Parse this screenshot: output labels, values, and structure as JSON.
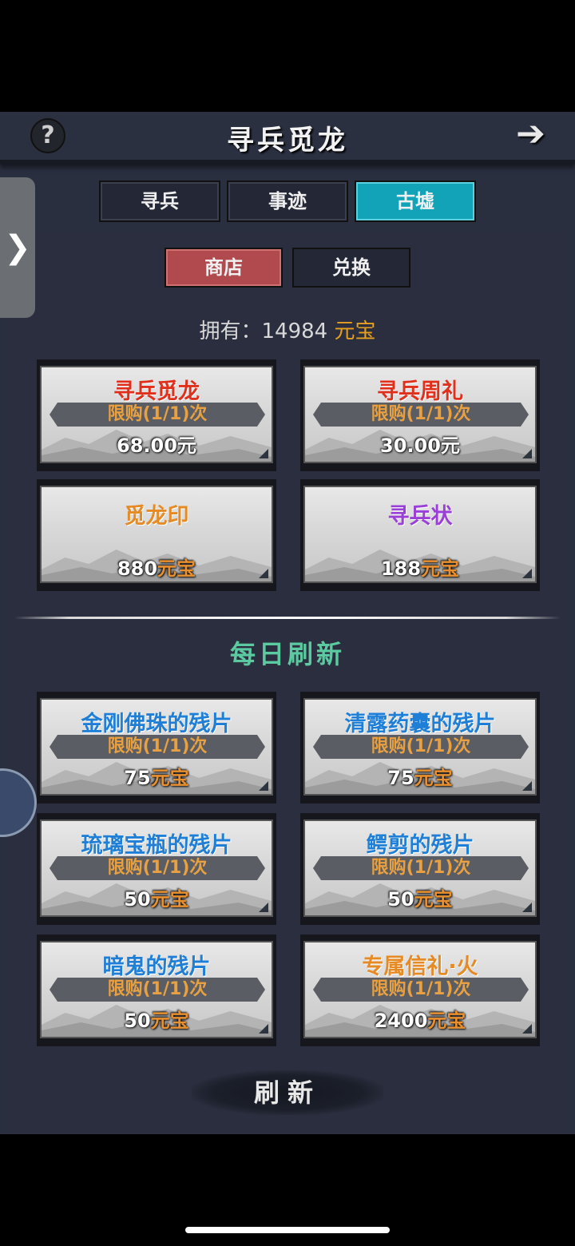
{
  "header": {
    "title": "寻兵觅龙",
    "help_icon": "?",
    "back_icon": "➔"
  },
  "main_tabs": [
    {
      "label": "寻兵",
      "active": false
    },
    {
      "label": "事迹",
      "active": false
    },
    {
      "label": "古墟",
      "active": true
    }
  ],
  "sub_tabs": [
    {
      "label": "商店",
      "active": true
    },
    {
      "label": "兑换",
      "active": false
    }
  ],
  "owned": {
    "label": "拥有：",
    "amount": "14984",
    "currency": "元宝"
  },
  "shop_items": [
    {
      "name": "寻兵觅龙",
      "limit": "限购(1/1)次",
      "price": "68.00元",
      "name_color": "#e0301c"
    },
    {
      "name": "寻兵周礼",
      "limit": "限购(1/1)次",
      "price": "30.00元",
      "name_color": "#e0301c"
    },
    {
      "name": "觅龙印",
      "price_value": "880",
      "price_currency": "元宝",
      "name_color": "#e58a24"
    },
    {
      "name": "寻兵状",
      "price_value": "188",
      "price_currency": "元宝",
      "name_color": "#9a40d8"
    }
  ],
  "daily": {
    "title": "每日刷新",
    "items": [
      {
        "name": "金刚佛珠的残片",
        "limit": "限购(1/1)次",
        "price_value": "75",
        "price_currency": "元宝",
        "name_color": "#1f7fd6"
      },
      {
        "name": "清露药囊的残片",
        "limit": "限购(1/1)次",
        "price_value": "75",
        "price_currency": "元宝",
        "name_color": "#1f7fd6"
      },
      {
        "name": "琉璃宝瓶的残片",
        "limit": "限购(1/1)次",
        "price_value": "50",
        "price_currency": "元宝",
        "name_color": "#1f7fd6"
      },
      {
        "name": "鳄剪的残片",
        "limit": "限购(1/1)次",
        "price_value": "50",
        "price_currency": "元宝",
        "name_color": "#1f7fd6"
      },
      {
        "name": "暗鬼的残片",
        "limit": "限购(1/1)次",
        "price_value": "50",
        "price_currency": "元宝",
        "name_color": "#1f7fd6"
      },
      {
        "name": "专属信礼·火",
        "limit": "限购(1/1)次",
        "price_value": "2400",
        "price_currency": "元宝",
        "name_color": "#e58a24"
      }
    ]
  },
  "refresh_button": {
    "label": "刷新"
  },
  "side_handle": {
    "icon": "❯"
  }
}
